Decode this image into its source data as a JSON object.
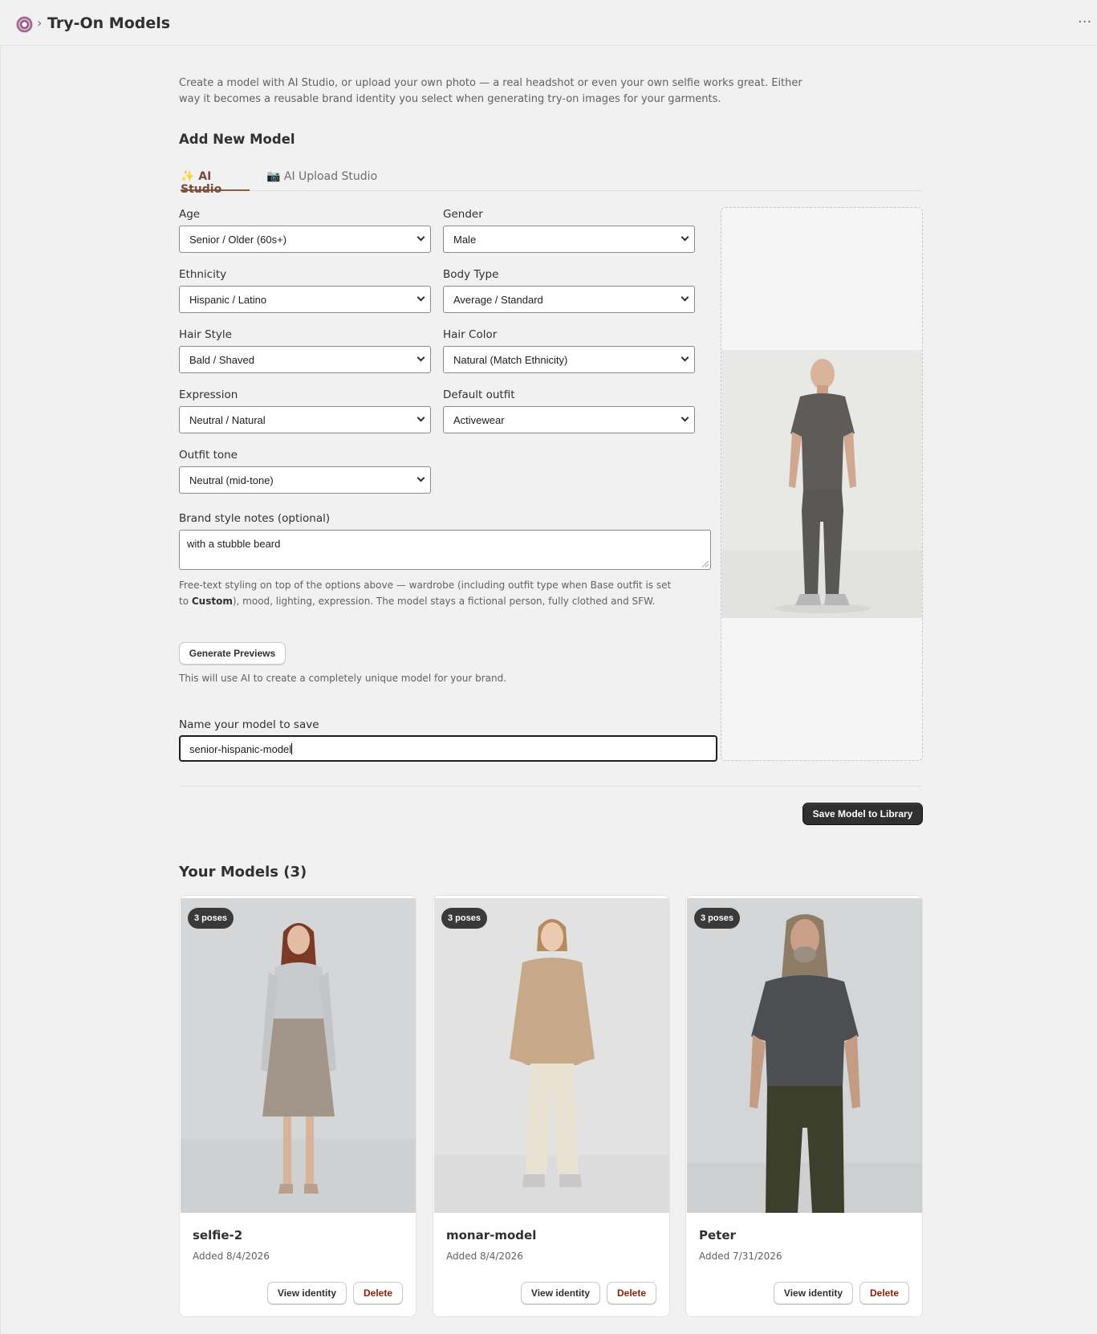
{
  "header": {
    "title": "Try-On Models",
    "separator": "›",
    "more_label": "···"
  },
  "intro": "Create a model with AI Studio, or upload your own photo — a real headshot or even your own selfie works great. Either way it becomes a reusable brand identity you select when generating try-on images for your garments.",
  "add_model": {
    "title": "Add New Model",
    "tabs": [
      {
        "label": "✨ AI Studio",
        "active": true
      },
      {
        "label": "📷 AI Upload Studio",
        "active": false
      }
    ],
    "fields": {
      "age": {
        "label": "Age",
        "value": "Senior / Older (60s+)"
      },
      "gender": {
        "label": "Gender",
        "value": "Male"
      },
      "ethnicity": {
        "label": "Ethnicity",
        "value": "Hispanic / Latino"
      },
      "body_type": {
        "label": "Body Type",
        "value": "Average / Standard"
      },
      "hair_style": {
        "label": "Hair Style",
        "value": "Bald / Shaved"
      },
      "hair_color": {
        "label": "Hair Color",
        "value": "Natural (Match Ethnicity)"
      },
      "expression": {
        "label": "Expression",
        "value": "Neutral / Natural"
      },
      "default_outfit": {
        "label": "Default outfit",
        "value": "Activewear"
      },
      "outfit_tone": {
        "label": "Outfit tone",
        "value": "Neutral (mid-tone)"
      }
    },
    "notes": {
      "label": "Brand style notes (optional)",
      "value": "with a stubble beard",
      "help_before": "Free-text styling on top of the options above — wardrobe (including outfit type when Base outfit is set to ",
      "help_bold": "Custom",
      "help_after": "), mood, lighting, expression. The model stays a fictional person, fully clothed and SFW."
    },
    "generate_label": "Generate Previews",
    "generate_hint": "This will use AI to create a completely unique model for your brand.",
    "name_label": "Name your model to save",
    "name_value": "senior-hispanic-model",
    "save_label": "Save Model to Library"
  },
  "models": {
    "title": "Your Models (3)",
    "items": [
      {
        "name": "selfie-2",
        "added": "Added 8/4/2026",
        "poses": "3 poses"
      },
      {
        "name": "monar-model",
        "added": "Added 8/4/2026",
        "poses": "3 poses"
      },
      {
        "name": "Peter",
        "added": "Added 7/31/2026",
        "poses": "3 poses"
      }
    ],
    "view_label": "View identity",
    "delete_label": "Delete"
  },
  "colors": {
    "accent_tab": "#7a4a3a",
    "primary_button": "#303030",
    "delete_text": "#8e1f0b"
  }
}
